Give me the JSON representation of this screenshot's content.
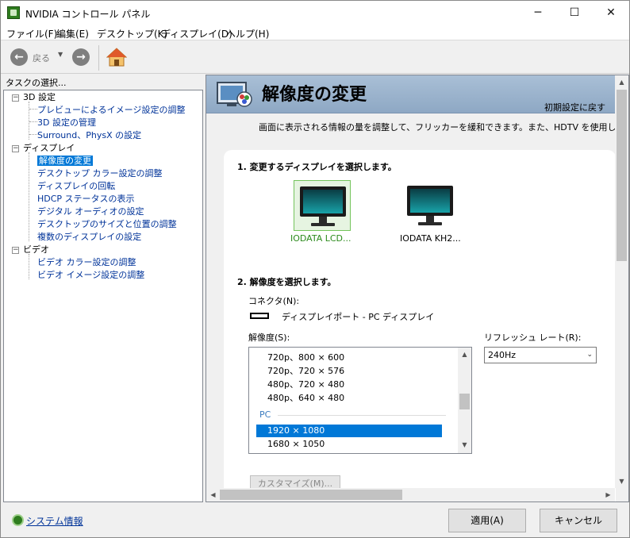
{
  "window": {
    "title": "NVIDIA コントロール パネル",
    "minimize": "─",
    "maximize": "☐",
    "close": "✕"
  },
  "menu": [
    "ファイル(F)",
    "編集(E)",
    "デスクトップ(K)",
    "ディスプレイ(D)",
    "ヘルプ(H)"
  ],
  "toolbar": {
    "back_label": "戻る"
  },
  "tasks_label": "タスクの選択...",
  "tree": {
    "cat_3d": "3D 設定",
    "items_3d": [
      "プレビューによるイメージ設定の調整",
      "3D 設定の管理",
      "Surround、PhysX の設定"
    ],
    "cat_display": "ディスプレイ",
    "items_display": [
      "解像度の変更",
      "デスクトップ カラー設定の調整",
      "ディスプレイの回転",
      "HDCP ステータスの表示",
      "デジタル オーディオの設定",
      "デスクトップのサイズと位置の調整",
      "複数のディスプレイの設定"
    ],
    "cat_video": "ビデオ",
    "items_video": [
      "ビデオ カラー設定の調整",
      "ビデオ イメージ設定の調整"
    ]
  },
  "page": {
    "title": "解像度の変更",
    "restore_defaults": "初期設定に戻す",
    "description": "画面に表示される情報の量を調整して、フリッカーを緩和できます。また、HDTV を使用している場",
    "section1": "1. 変更するディスプレイを選択します。",
    "displays": [
      "IODATA LCD...",
      "IODATA KH2..."
    ],
    "section2": "2. 解像度を選択します。",
    "connector_label": "コネクタ(N):",
    "connector_value": "ディスプレイポート - PC ディスプレイ",
    "resolution_label": "解像度(S):",
    "resolutions_tv": [
      "720p、800 × 600",
      "720p、720 × 576",
      "480p、720 × 480",
      "480p、640 × 480"
    ],
    "group_pc": "PC",
    "resolutions_pc": [
      "1920 × 1080",
      "1680 × 1050"
    ],
    "refresh_label": "リフレッシュ レート(R):",
    "refresh_value": "240Hz",
    "customize": "カスタマイズ(M)..."
  },
  "footer": {
    "system_info": "システム情報",
    "apply": "適用(A)",
    "cancel": "キャンセル"
  }
}
